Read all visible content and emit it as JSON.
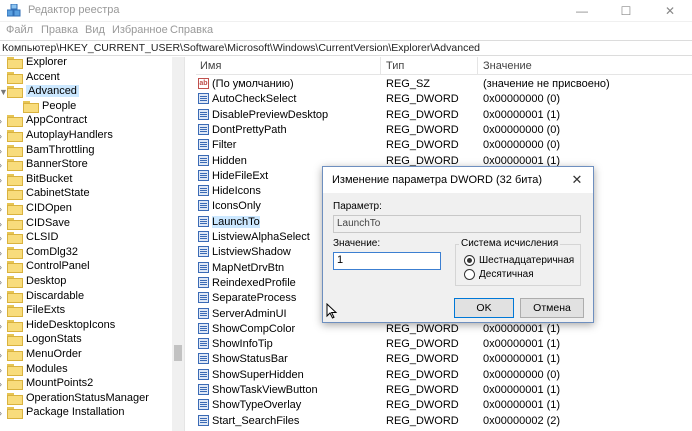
{
  "window": {
    "title": "Редактор реестра",
    "minimize_glyph": "—",
    "maximize_glyph": "☐",
    "close_glyph": "✕"
  },
  "menu": [
    "Файл",
    "Правка",
    "Вид",
    "Избранное",
    "Справка"
  ],
  "address": "Компьютер\\HKEY_CURRENT_USER\\Software\\Microsoft\\Windows\\CurrentVersion\\Explorer\\Advanced",
  "tree": {
    "items": [
      {
        "label": "Explorer",
        "expander": ""
      },
      {
        "label": "Accent",
        "expander": ""
      },
      {
        "label": "Advanced",
        "expander": "▼",
        "selected": true
      },
      {
        "label": "People",
        "expander": ""
      },
      {
        "label": "AppContract",
        "expander": "›"
      },
      {
        "label": "AutoplayHandlers",
        "expander": "›"
      },
      {
        "label": "BamThrottling",
        "expander": "›"
      },
      {
        "label": "BannerStore",
        "expander": "›"
      },
      {
        "label": "BitBucket",
        "expander": "›"
      },
      {
        "label": "CabinetState",
        "expander": ""
      },
      {
        "label": "CIDOpen",
        "expander": "›"
      },
      {
        "label": "CIDSave",
        "expander": "›"
      },
      {
        "label": "CLSID",
        "expander": "›"
      },
      {
        "label": "ComDlg32",
        "expander": "›"
      },
      {
        "label": "ControlPanel",
        "expander": "›"
      },
      {
        "label": "Desktop",
        "expander": "›"
      },
      {
        "label": "Discardable",
        "expander": "›"
      },
      {
        "label": "FileExts",
        "expander": "›"
      },
      {
        "label": "HideDesktopIcons",
        "expander": "›"
      },
      {
        "label": "LogonStats",
        "expander": ""
      },
      {
        "label": "MenuOrder",
        "expander": "›"
      },
      {
        "label": "Modules",
        "expander": "›"
      },
      {
        "label": "MountPoints2",
        "expander": "›"
      },
      {
        "label": "OperationStatusManager",
        "expander": ""
      },
      {
        "label": "Package Installation",
        "expander": "›"
      }
    ]
  },
  "list": {
    "headers": {
      "name": "Имя",
      "type": "Тип",
      "data": "Значение"
    },
    "rows": [
      {
        "icon": "string-value-icon",
        "name": "(По умолчанию)",
        "type": "REG_SZ",
        "data": "(значение не присвоено)"
      },
      {
        "icon": "binary-value-icon",
        "name": "AutoCheckSelect",
        "type": "REG_DWORD",
        "data": "0x00000000 (0)"
      },
      {
        "icon": "binary-value-icon",
        "name": "DisablePreviewDesktop",
        "type": "REG_DWORD",
        "data": "0x00000001 (1)"
      },
      {
        "icon": "binary-value-icon",
        "name": "DontPrettyPath",
        "type": "REG_DWORD",
        "data": "0x00000000 (0)"
      },
      {
        "icon": "binary-value-icon",
        "name": "Filter",
        "type": "REG_DWORD",
        "data": "0x00000000 (0)"
      },
      {
        "icon": "binary-value-icon",
        "name": "Hidden",
        "type": "REG_DWORD",
        "data": "0x00000001 (1)"
      },
      {
        "icon": "binary-value-icon",
        "name": "HideFileExt",
        "type": "",
        "data": ""
      },
      {
        "icon": "binary-value-icon",
        "name": "HideIcons",
        "type": "",
        "data": ""
      },
      {
        "icon": "binary-value-icon",
        "name": "IconsOnly",
        "type": "",
        "data": ""
      },
      {
        "icon": "binary-value-icon",
        "name": "LaunchTo",
        "type": "",
        "data": "",
        "selected": true
      },
      {
        "icon": "binary-value-icon",
        "name": "ListviewAlphaSelect",
        "type": "",
        "data": ""
      },
      {
        "icon": "binary-value-icon",
        "name": "ListviewShadow",
        "type": "",
        "data": ""
      },
      {
        "icon": "binary-value-icon",
        "name": "MapNetDrvBtn",
        "type": "",
        "data": ""
      },
      {
        "icon": "binary-value-icon",
        "name": "ReindexedProfile",
        "type": "",
        "data": ""
      },
      {
        "icon": "binary-value-icon",
        "name": "SeparateProcess",
        "type": "",
        "data": ""
      },
      {
        "icon": "binary-value-icon",
        "name": "ServerAdminUI",
        "type": "",
        "data": ""
      },
      {
        "icon": "binary-value-icon",
        "name": "ShowCompColor",
        "type": "REG_DWORD",
        "data": "0x00000001 (1)"
      },
      {
        "icon": "binary-value-icon",
        "name": "ShowInfoTip",
        "type": "REG_DWORD",
        "data": "0x00000001 (1)"
      },
      {
        "icon": "binary-value-icon",
        "name": "ShowStatusBar",
        "type": "REG_DWORD",
        "data": "0x00000001 (1)"
      },
      {
        "icon": "binary-value-icon",
        "name": "ShowSuperHidden",
        "type": "REG_DWORD",
        "data": "0x00000000 (0)"
      },
      {
        "icon": "binary-value-icon",
        "name": "ShowTaskViewButton",
        "type": "REG_DWORD",
        "data": "0x00000001 (1)"
      },
      {
        "icon": "binary-value-icon",
        "name": "ShowTypeOverlay",
        "type": "REG_DWORD",
        "data": "0x00000001 (1)"
      },
      {
        "icon": "binary-value-icon",
        "name": "Start_SearchFiles",
        "type": "REG_DWORD",
        "data": "0x00000002 (2)"
      }
    ]
  },
  "dialog": {
    "title": "Изменение параметра DWORD (32 бита)",
    "close_glyph": "✕",
    "name_label": "Параметр:",
    "name_value": "LaunchTo",
    "value_label": "Значение:",
    "value": "1",
    "radix_label": "Система исчисления",
    "radix_hex": "Шестнадцатеричная",
    "radix_dec": "Десятичная",
    "ok": "OK",
    "cancel": "Отмена"
  }
}
